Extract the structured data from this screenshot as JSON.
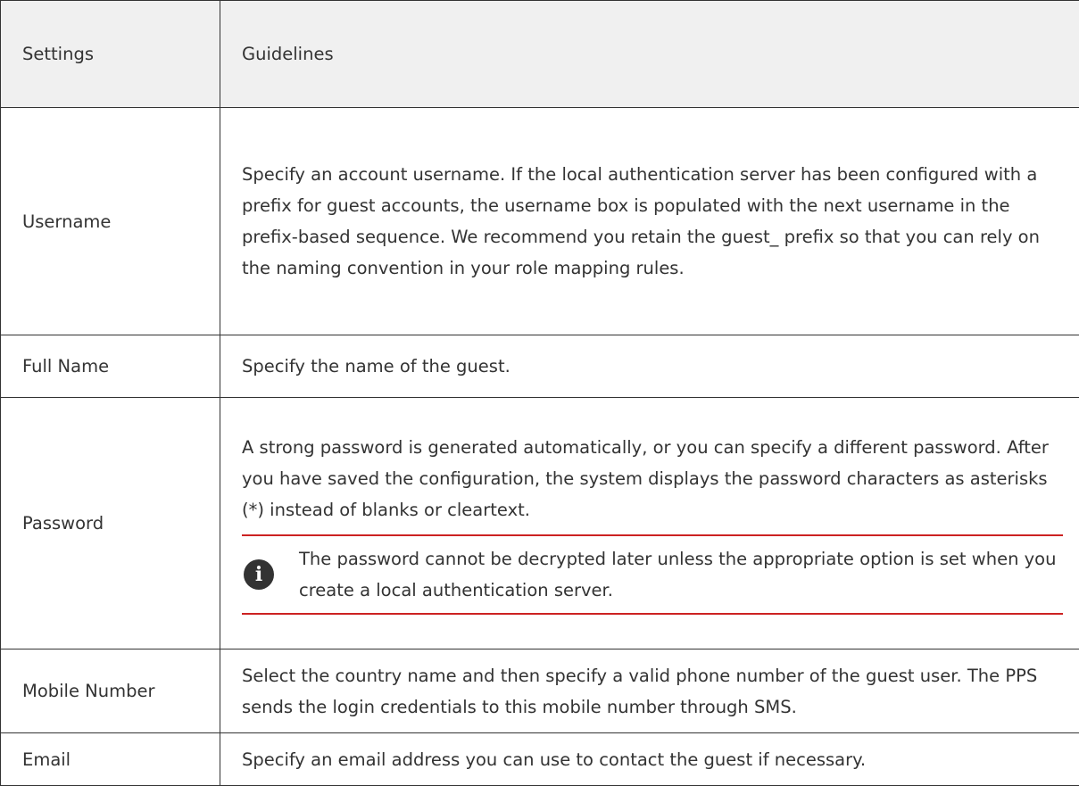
{
  "table": {
    "headers": {
      "settings": "Settings",
      "guidelines": "Guidelines"
    },
    "rows": [
      {
        "setting": "Username",
        "guideline": "Specify an account username. If the local authentication server has been configured with a prefix for guest accounts, the username box is populated with the next username in the prefix-based sequence. We recommend you retain the guest_ prefix so that you can rely on the naming convention in your role mapping rules."
      },
      {
        "setting": "Full Name",
        "guideline": "Specify the name of the guest."
      },
      {
        "setting": "Password",
        "guideline": "A strong password is generated automatically, or you can specify a different password. After you have saved the configuration, the system displays the password characters as asterisks (*) instead of blanks or cleartext.",
        "note": {
          "icon": "info-icon",
          "icon_glyph": "i",
          "text": "The password cannot be decrypted later unless the appropriate option is set when you create a local authentication server."
        }
      },
      {
        "setting": "Mobile Number",
        "guideline": "Select the country name and then specify a valid phone number of the guest user. The PPS sends the login credentials to this mobile number through SMS."
      },
      {
        "setting": "Email",
        "guideline": "Specify an email address you can use to contact the guest if necessary."
      }
    ]
  },
  "colors": {
    "header_bg": "#f0f0f0",
    "border": "#333333",
    "note_rule": "#cc2222",
    "text": "#333333"
  }
}
